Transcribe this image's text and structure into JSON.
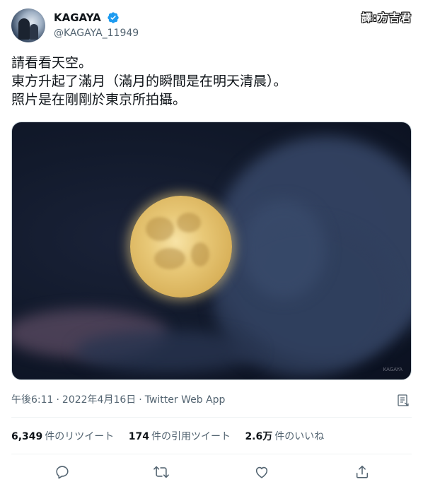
{
  "user": {
    "display_name": "KAGAYA",
    "handle": "@KAGAYA_11949",
    "verified": true,
    "avatar_icon": "profile-photo"
  },
  "translator_note": "譯:方吉君",
  "tweet": {
    "lines": [
      "請看看天空。",
      "東方升起了滿月（滿月的瞬間是在明天清晨）。",
      "照片是在剛剛於東京所拍攝。"
    ]
  },
  "media": {
    "watermark": "KAGAYA"
  },
  "meta": {
    "time": "午後6:11",
    "date": "2022年4月16日",
    "source": "Twitter Web App",
    "separator": "·"
  },
  "stats": [
    {
      "num": "6,349",
      "label": "件のリツイート"
    },
    {
      "num": "174",
      "label": "件の引用ツイート"
    },
    {
      "num": "2.6万",
      "label": "件のいいね"
    }
  ],
  "actions": [
    "reply-icon",
    "retweet-icon",
    "like-icon",
    "share-icon"
  ],
  "colors": {
    "verified": "#1d9bf0",
    "secondary_text": "#536471",
    "divider": "#eff3f4"
  }
}
